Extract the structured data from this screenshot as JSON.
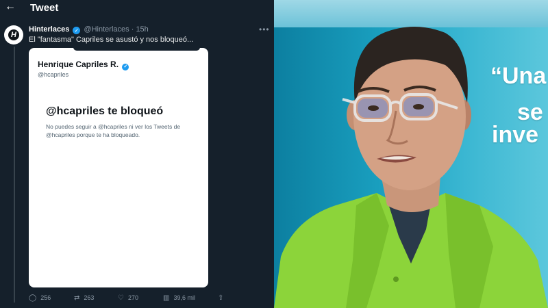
{
  "header": {
    "back_icon": "arrow-left-icon",
    "title": "Tweet"
  },
  "tweet": {
    "author": "Hinterlaces",
    "handle": "@Hinterlaces",
    "separator": "·",
    "time": "15h",
    "more_icon": "more-dots-icon",
    "text": "El \"fantasma\" Capriles se asustó y nos bloqueó..."
  },
  "card": {
    "name": "Henrique Capriles R.",
    "handle": "@hcapriles",
    "block_title": "@hcapriles te bloqueó",
    "block_desc": "No puedes seguir a @hcapriles ni ver los Tweets de @hcapriles porque te ha bloqueado."
  },
  "actions": {
    "replies": "256",
    "retweets": "263",
    "likes": "270",
    "views": "39,6 mil"
  },
  "photo": {
    "wall_line1": "“Una",
    "wall_line2": "se",
    "wall_line3": "inve"
  },
  "colors": {
    "bg": "#15202b",
    "verified": "#1d9bf0",
    "muted": "#8b98a5",
    "shirt": "#8cd43a"
  }
}
